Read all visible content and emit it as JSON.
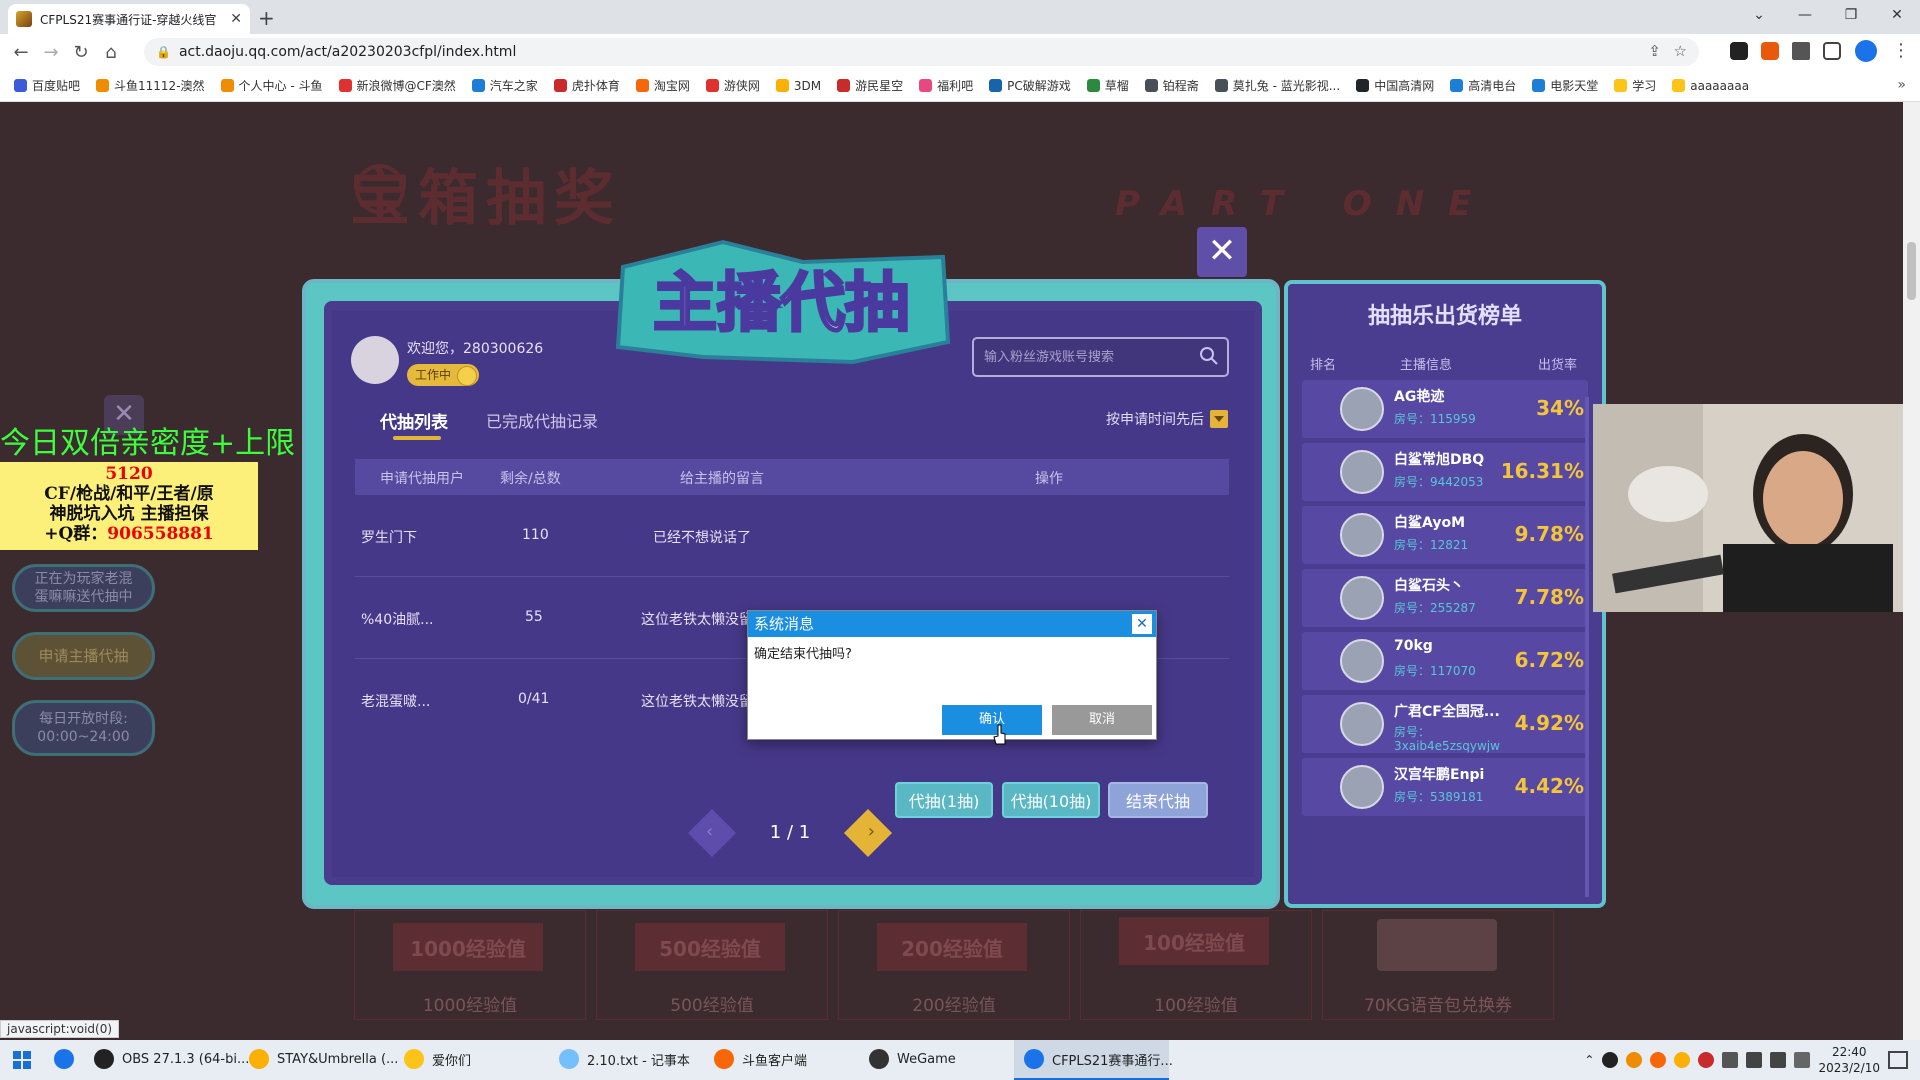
{
  "browser": {
    "tab_title": "CFPLS21赛事通行证-穿越火线官",
    "url": "act.daoju.qq.com/act/a20230203cfpl/index.html",
    "bookmarks": [
      {
        "label": "百度贴吧",
        "color": "#3b5bdb"
      },
      {
        "label": "斗鱼11112-澳然",
        "color": "#f08c00"
      },
      {
        "label": "个人中心 - 斗鱼",
        "color": "#f08c00"
      },
      {
        "label": "新浪微博@CF澳然",
        "color": "#e03131"
      },
      {
        "label": "汽车之家",
        "color": "#1c7ed6"
      },
      {
        "label": "虎扑体育",
        "color": "#c92a2a"
      },
      {
        "label": "淘宝网",
        "color": "#f76707"
      },
      {
        "label": "游侠网",
        "color": "#e03131"
      },
      {
        "label": "3DM",
        "color": "#fab005"
      },
      {
        "label": "游民星空",
        "color": "#c92a2a"
      },
      {
        "label": "福利吧",
        "color": "#e64980"
      },
      {
        "label": "PC破解游戏",
        "color": "#1864ab"
      },
      {
        "label": "草榴",
        "color": "#2b8a3e"
      },
      {
        "label": "铂程斋",
        "color": "#495057"
      },
      {
        "label": "莫扎兔 - 蓝光影视...",
        "color": "#495057"
      },
      {
        "label": "中国高清网",
        "color": "#212529"
      },
      {
        "label": "高清电台",
        "color": "#1c7ed6"
      },
      {
        "label": "电影天堂",
        "color": "#1c7ed6"
      },
      {
        "label": "学习",
        "color": "#fcc419"
      },
      {
        "label": "aaaaaaaa",
        "color": "#fcc419"
      }
    ],
    "status_url": "javascript:void(0)"
  },
  "background": {
    "title": "宝箱抽奖",
    "part": "PART ONE",
    "rewards": [
      {
        "button": "1000经验值",
        "label": "1000经验值"
      },
      {
        "button": "500经验值",
        "label": "500经验值"
      },
      {
        "button": "200经验值",
        "label": "200经验值"
      },
      {
        "button": "100经验值",
        "label": "100经验值"
      },
      {
        "button": "",
        "label": "70KG语音包兑换券"
      }
    ]
  },
  "side": {
    "pill1": "正在为玩家老混蛋嘛嘛送代抽中",
    "pill2": "申请主播代抽",
    "pill3_line1": "每日开放时段:",
    "pill3_line2": "00:00~24:00"
  },
  "overlay": {
    "green_text": "今日双倍亲密度+上限",
    "yellow_l1": "5120",
    "yellow_l2": "CF/枪战/和平/王者/原",
    "yellow_l3": "神脱坑入坑 主播担保",
    "yellow_l4_prefix": "+Q群：",
    "yellow_l4_number": "906558881"
  },
  "modal": {
    "logo_text": "主播代抽",
    "welcome": "欢迎您，280300626",
    "status": "工作中",
    "search_placeholder": "输入粉丝游戏账号搜索",
    "tabs": [
      "代抽列表",
      "已完成代抽记录"
    ],
    "sort_label": "按申请时间先后",
    "columns": [
      "申请代抽用户",
      "剩余/总数",
      "给主播的留言",
      "操作"
    ],
    "rows": [
      {
        "user": "罗生门下",
        "count": "110",
        "message": "已经不想说话了"
      },
      {
        "user": "%40油腻...",
        "count": "55",
        "message": "这位老铁太懒没留"
      },
      {
        "user": "老混蛋啵...",
        "count": "0/41",
        "message": "这位老铁太懒没留下什么~"
      }
    ],
    "actions": {
      "draw1": "代抽(1抽)",
      "draw10": "代抽(10抽)",
      "end": "结束代抽"
    },
    "pager": "1 / 1"
  },
  "ranking": {
    "title": "抽抽乐出货榜单",
    "headers": [
      "排名",
      "主播信息",
      "出货率"
    ],
    "rows": [
      {
        "name": "AG艳迹",
        "room": "房号：115959",
        "rate": "34%"
      },
      {
        "name": "白鲨常旭DBQ",
        "room": "房号：9442053",
        "rate": "16.31%"
      },
      {
        "name": "白鲨AyoM",
        "room": "房号：12821",
        "rate": "9.78%"
      },
      {
        "name": "白鲨石头丶",
        "room": "房号：255287",
        "rate": "7.78%"
      },
      {
        "name": "70kg",
        "room": "房号：117070",
        "rate": "6.72%"
      },
      {
        "name": "广君CF全国冠...",
        "room": "房号：3xaib4e5zsqywjw",
        "rate": "4.92%"
      },
      {
        "name": "汉宫年鹏Enpi",
        "room": "房号：5389181",
        "rate": "4.42%"
      }
    ]
  },
  "dialog": {
    "title": "系统消息",
    "message": "确定结束代抽吗?",
    "ok": "确认",
    "cancel": "取消"
  },
  "taskbar": {
    "apps": [
      {
        "label": "",
        "color": "#1a73e8"
      },
      {
        "label": "OBS 27.1.3 (64-bi...",
        "color": "#222"
      },
      {
        "label": "STAY&Umbrella (...",
        "color": "#fab005"
      },
      {
        "label": "爱你们",
        "color": "#fcc419"
      },
      {
        "label": "2.10.txt - 记事本",
        "color": "#74c0fc"
      },
      {
        "label": "斗鱼客户端",
        "color": "#f76707"
      },
      {
        "label": "WeGame",
        "color": "#333"
      },
      {
        "label": "CFPLS21赛事通行...",
        "color": "#1a73e8"
      }
    ],
    "time": "22:40",
    "date": "2023/2/10"
  }
}
